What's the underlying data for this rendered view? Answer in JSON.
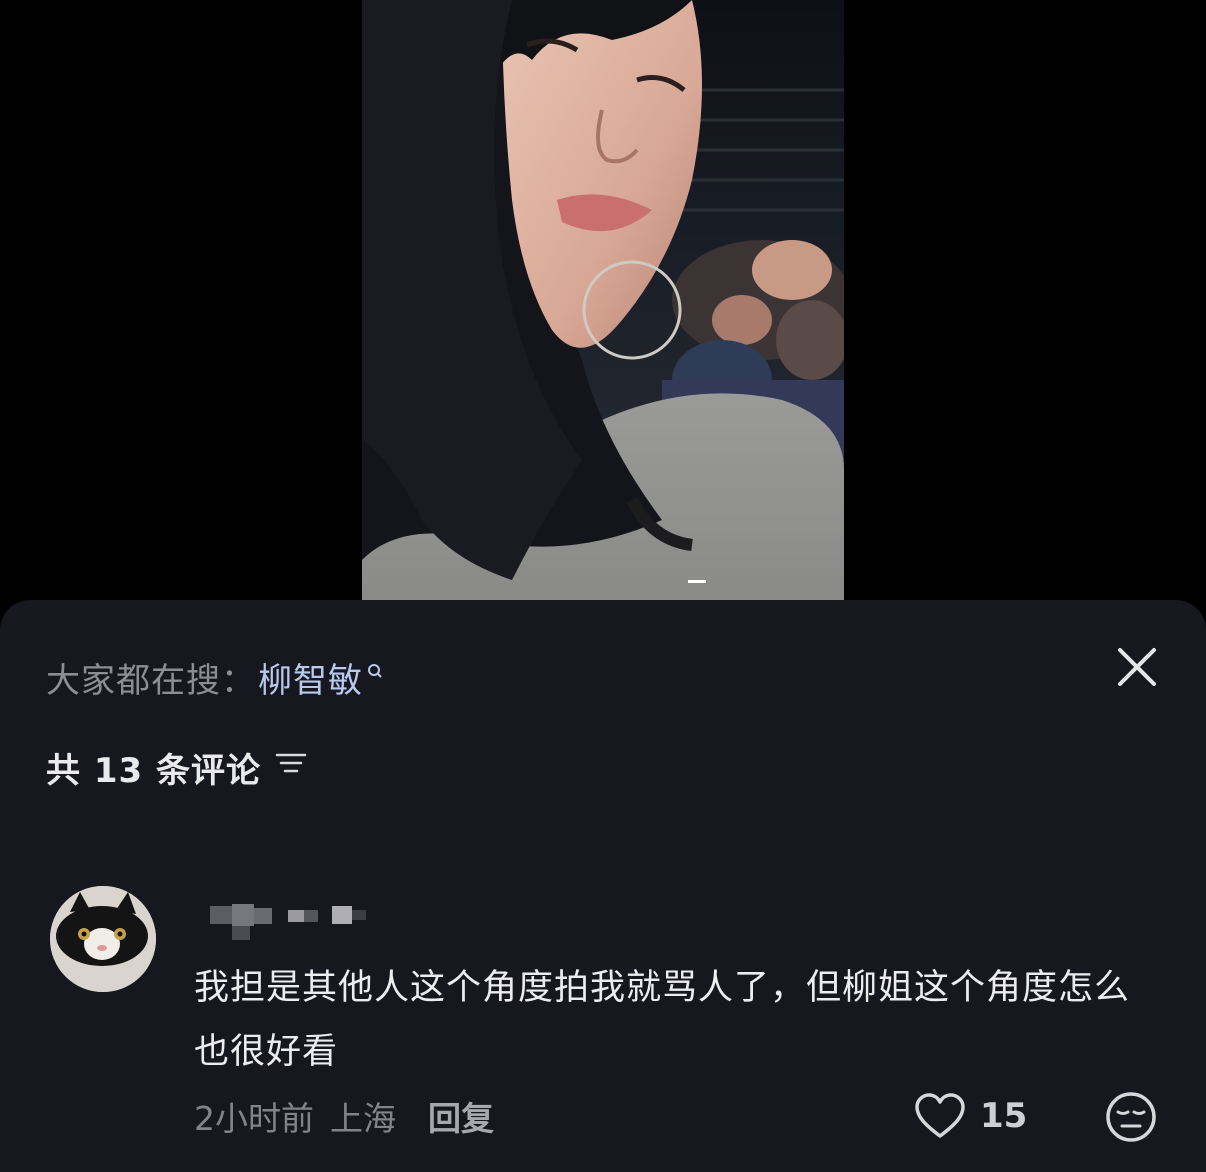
{
  "search_hint": {
    "prefix": "大家都在搜：",
    "term": "柳智敏",
    "icon": "search-icon"
  },
  "close_icon": "close-icon",
  "comments_header": {
    "count_label": "共 13 条评论",
    "sort_icon": "sort-icon"
  },
  "comment": {
    "text": "我担是其他人这个角度拍我就骂人了，但柳姐这个角度怎么也很好看",
    "time": "2小时前",
    "location": "上海",
    "reply_label": "回复",
    "like_count": "15",
    "like_icon": "heart-icon",
    "emoji_icon": "emoji-face-icon"
  },
  "colors": {
    "sheet_bg": "#17171f",
    "accent_link": "#b9c9ee",
    "muted_text": "#8d8e95"
  }
}
